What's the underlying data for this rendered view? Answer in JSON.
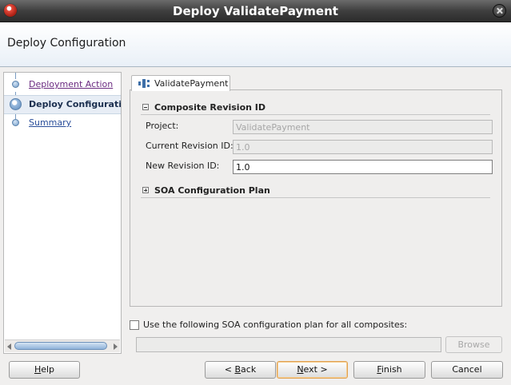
{
  "window": {
    "title": "Deploy ValidatePayment"
  },
  "header": {
    "title": "Deploy Configuration"
  },
  "steps": [
    {
      "label": "Deployment Action",
      "state": "visited"
    },
    {
      "label": "Deploy Configuration",
      "state": "current"
    },
    {
      "label": "Summary",
      "state": "link"
    }
  ],
  "tab": {
    "label": "ValidatePayment"
  },
  "composite_revision": {
    "title": "Composite Revision ID",
    "expanded": true,
    "project_label": "Project:",
    "project_value": "ValidatePayment",
    "current_label": "Current Revision ID:",
    "current_value": "1.0",
    "new_label": "New Revision ID:",
    "new_value": "1.0"
  },
  "soa_plan_section": {
    "title": "SOA Configuration Plan",
    "expanded": false
  },
  "plan_option": {
    "checkbox_label": "Use the following SOA configuration plan for all composites:",
    "checked": false,
    "path_value": "",
    "browse_label": "Browse"
  },
  "buttons": {
    "help": {
      "pre": "",
      "mn": "H",
      "post": "elp"
    },
    "back": {
      "pre": "< ",
      "mn": "B",
      "post": "ack"
    },
    "next": {
      "pre": "",
      "mn": "N",
      "post": "ext >"
    },
    "finish": {
      "pre": "",
      "mn": "F",
      "post": "inish"
    },
    "cancel": {
      "label": "Cancel"
    }
  },
  "colors": {
    "visited_link": "#6a2a80",
    "link": "#2a4e9a",
    "default_button_border": "#e0a050"
  }
}
